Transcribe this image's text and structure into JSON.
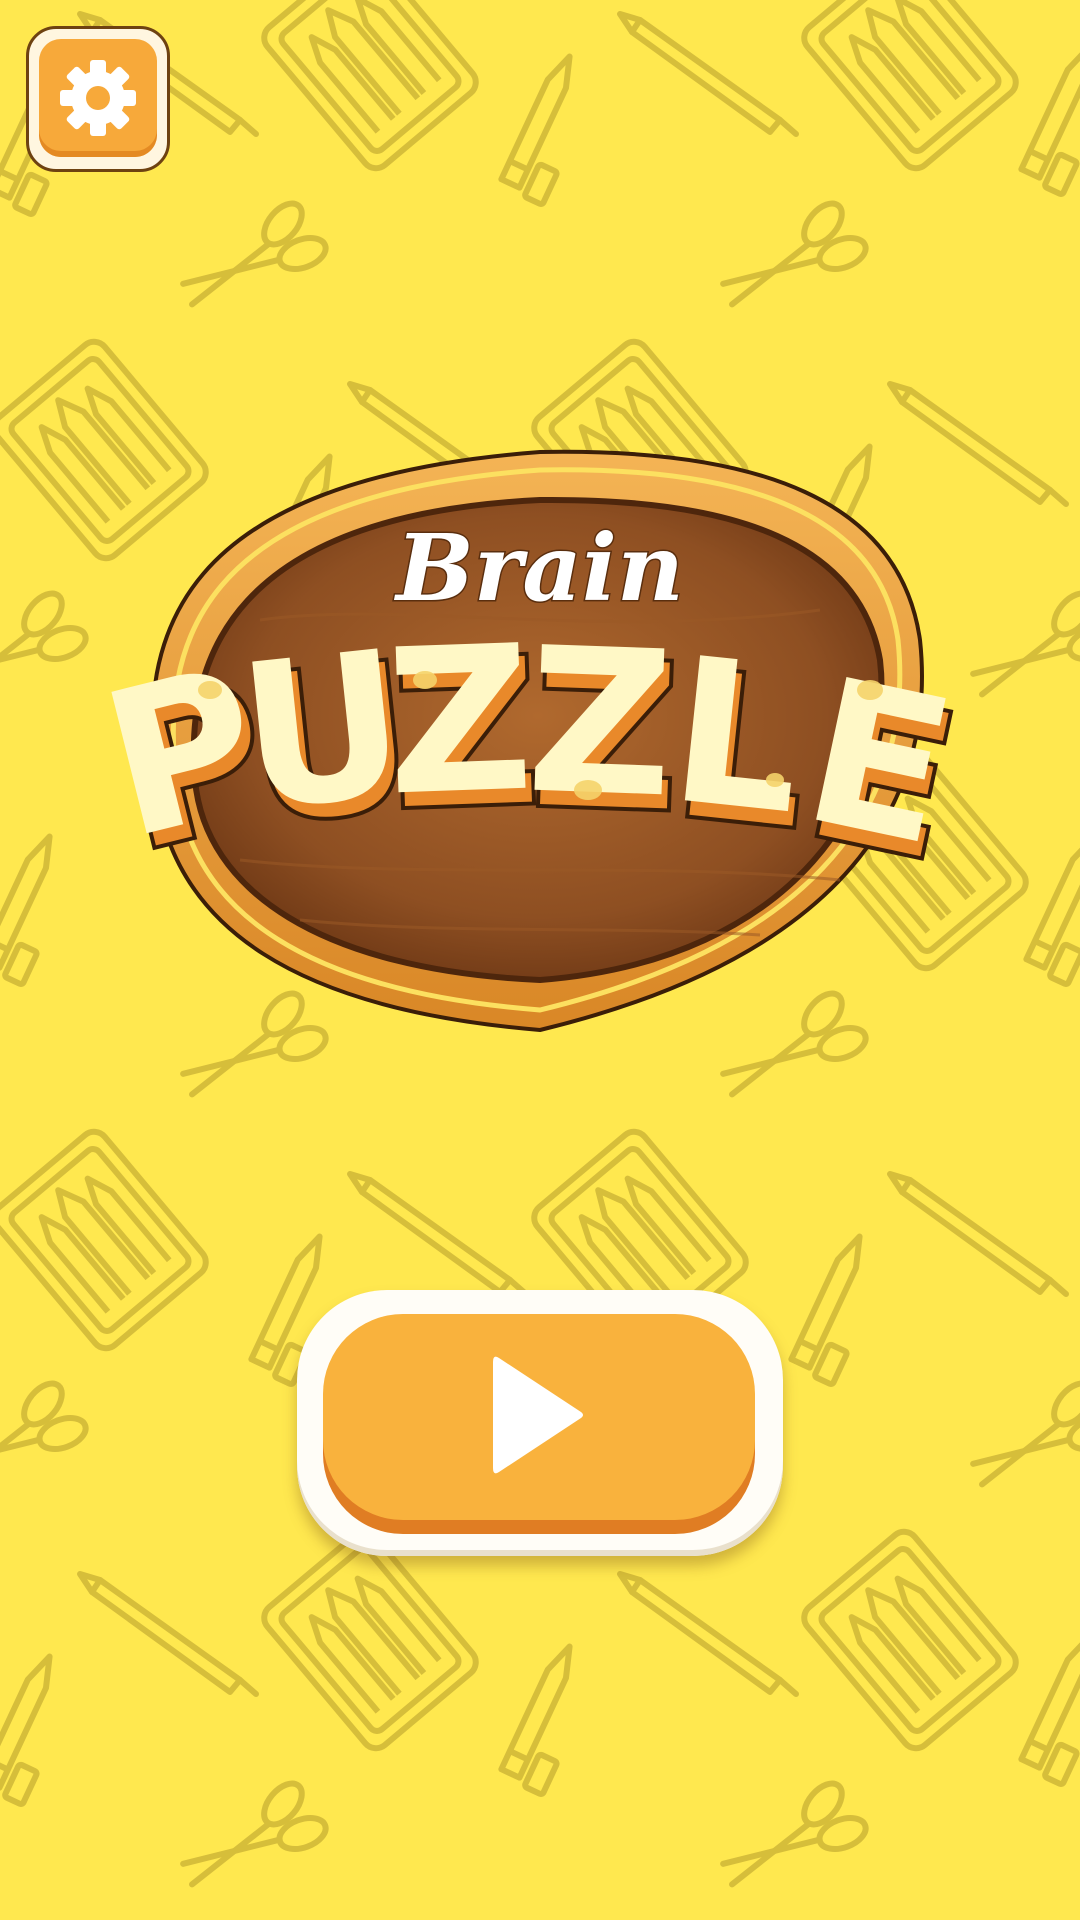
{
  "screen": "main-menu",
  "logo": {
    "line1": "Brain",
    "line2_letters": [
      "P",
      "U",
      "Z",
      "Z",
      "L",
      "E"
    ]
  },
  "colors": {
    "background": "#FFE84F",
    "pattern": "#D8C03C",
    "button_orange": "#F9B23D",
    "button_shadow": "#E07D23",
    "board_brown": "#8A4A1E",
    "board_frame": "#E49A35",
    "letter_cream": "#FFF8C6"
  },
  "icons": {
    "settings": "gear-icon",
    "play": "play-icon"
  }
}
